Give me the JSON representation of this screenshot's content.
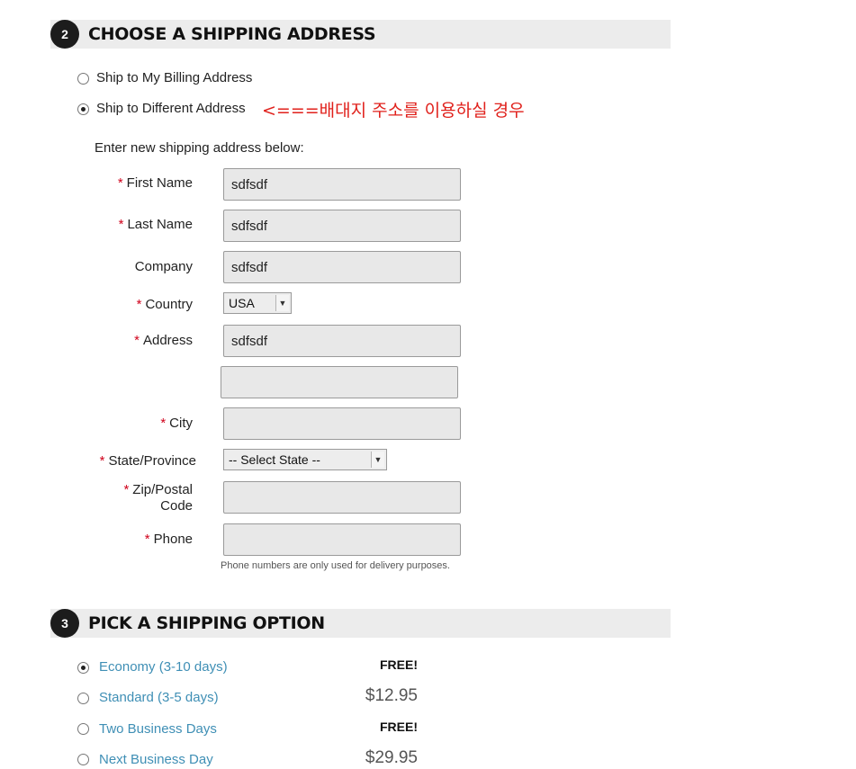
{
  "section2": {
    "step": "2",
    "title": "CHOOSE A SHIPPING ADDRESS"
  },
  "address_options": [
    {
      "label": "Ship to My Billing Address",
      "selected": false
    },
    {
      "label": "Ship to Different Address",
      "selected": true
    }
  ],
  "annotation": "<===배대지 주소를 이용하실 경우",
  "form": {
    "intro": "Enter new shipping address below:",
    "required_mark": "*",
    "first_name": {
      "label": "First Name",
      "value": "sdfsdf"
    },
    "last_name": {
      "label": "Last Name",
      "value": "sdfsdf"
    },
    "company": {
      "label": "Company",
      "value": "sdfsdf"
    },
    "country": {
      "label": "Country",
      "value": "USA"
    },
    "address": {
      "label": "Address",
      "value": "sdfsdf",
      "line2": ""
    },
    "city": {
      "label": "City",
      "value": ""
    },
    "state": {
      "label": "State/Province",
      "value": "-- Select State --"
    },
    "zip": {
      "label_line1": "Zip/Postal",
      "label_line2": "Code",
      "value": ""
    },
    "phone": {
      "label": "Phone",
      "value": "",
      "note": "Phone numbers are only used for delivery purposes."
    }
  },
  "section3": {
    "step": "3",
    "title": "PICK A SHIPPING OPTION"
  },
  "shipping_options": [
    {
      "name": "Economy (3-10 days)",
      "price": "FREE!",
      "selected": true
    },
    {
      "name": "Standard (3-5 days)",
      "price": "$12.95",
      "selected": false
    },
    {
      "name": "Two Business Days",
      "price": "FREE!",
      "selected": false
    },
    {
      "name": "Next Business Day",
      "price": "$29.95",
      "selected": false
    }
  ],
  "colors": {
    "accent_link": "#3f8fb5",
    "required": "#d0021b",
    "annotation": "#e0201b"
  }
}
